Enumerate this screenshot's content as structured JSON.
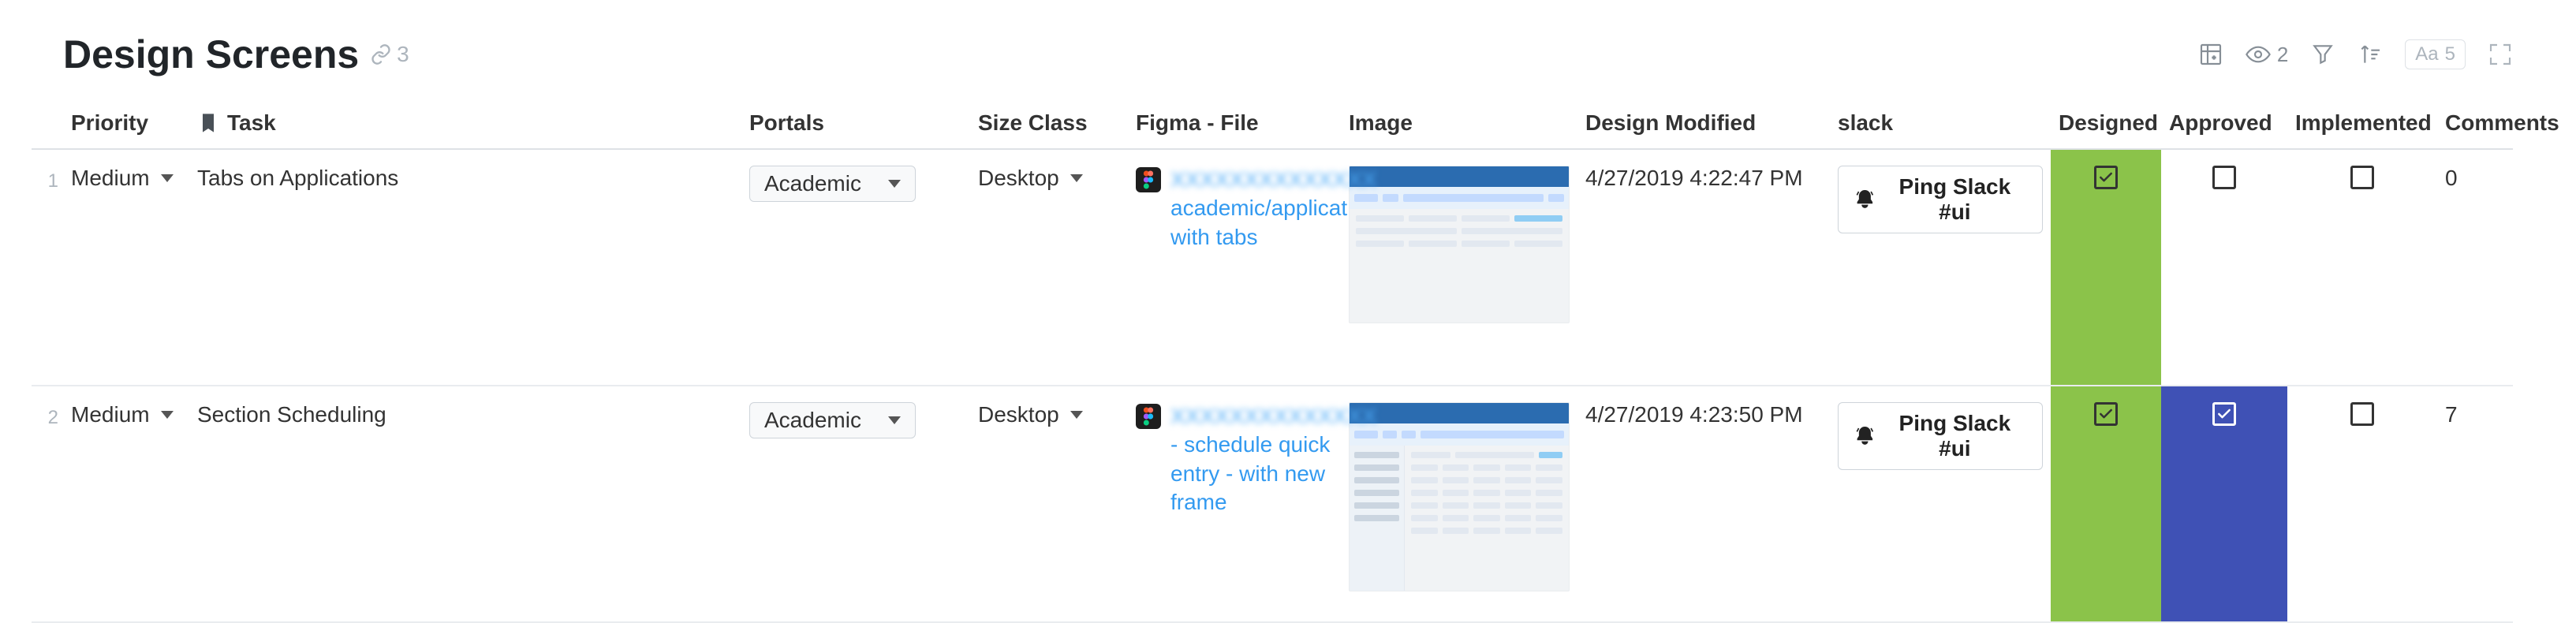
{
  "header": {
    "title": "Design Screens",
    "link_count": "3"
  },
  "toolbar": {
    "views_count": "2",
    "row_font_label": "Aa",
    "row_height_value": "5"
  },
  "columns": {
    "priority": "Priority",
    "task": "Task",
    "portals": "Portals",
    "size_class": "Size Class",
    "figma": "Figma - File",
    "image": "Image",
    "design_modified": "Design Modified",
    "slack": "slack",
    "designed": "Designed",
    "approved": "Approved",
    "implemented": "Implemented",
    "comments": "Comments"
  },
  "rows": [
    {
      "num": "1",
      "priority": "Medium",
      "task": "Tabs on Applications",
      "portal": "Academic",
      "size_class": "Desktop",
      "figma_blur": "XXXXXXXXXXXXXX",
      "figma_link": "academic/applications with tabs",
      "modified": "4/27/2019 4:22:47 PM",
      "slack_label": "Ping Slack #ui",
      "designed": true,
      "approved": false,
      "implemented": false,
      "comments": "0"
    },
    {
      "num": "2",
      "priority": "Medium",
      "task": "Section Scheduling",
      "portal": "Academic",
      "size_class": "Desktop",
      "figma_blur": "XXXXXXXXXXXXXX",
      "figma_link": "- schedule quick entry - with new frame",
      "modified": "4/27/2019 4:23:50 PM",
      "slack_label": "Ping Slack #ui",
      "designed": true,
      "approved": true,
      "implemented": false,
      "comments": "7"
    }
  ]
}
